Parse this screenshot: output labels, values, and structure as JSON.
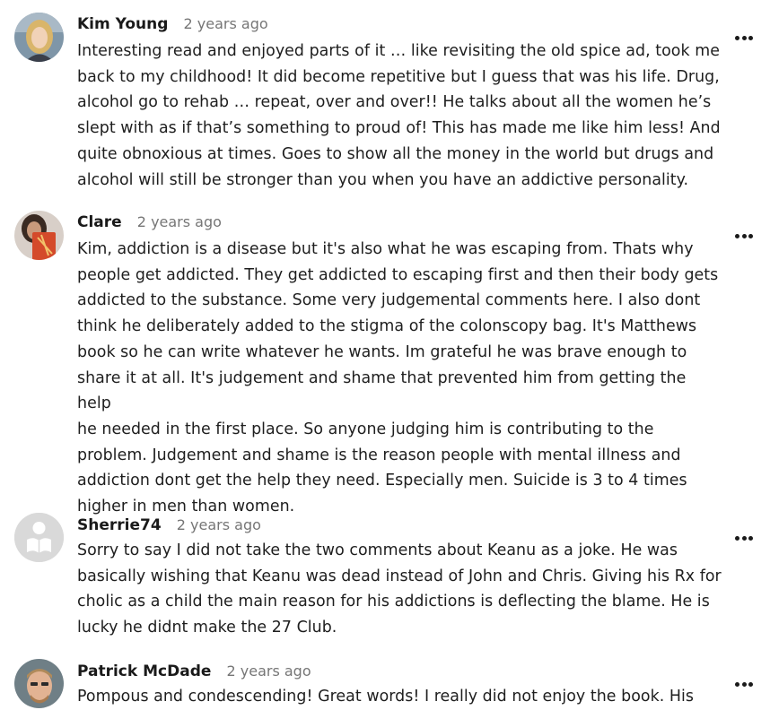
{
  "comments": [
    {
      "author": "Kim Young",
      "time": "2 years ago",
      "text": "Interesting read and enjoyed parts of it … like revisiting the old spice ad, took me\nback to my childhood! It did become repetitive but I guess that was his life. Drug,\nalcohol go to rehab … repeat, over and over!! He talks about all the women he’s\nslept with as if that’s something to proud of! This has made me like him less! And\nquite obnoxious at times. Goes to show all the money in the world but drugs and\nalcohol will still be stronger than you when you have an addictive personality."
    },
    {
      "author": "Clare",
      "time": "2 years ago",
      "text": "Kim, addiction is a disease but it's also what he was escaping from. Thats why\npeople get addicted. They get addicted to escaping first and then their body gets\naddicted to the substance. Some very judgemental comments here. I also dont\nthink he deliberately added to the stigma of the colonscopy bag. It's Matthews\nbook so he can write whatever he wants. Im grateful he was brave enough to\nshare it at all. It's judgement and shame that prevented him from getting the help\nhe needed in the first place. So anyone judging him is contributing to the\nproblem. Judgement and shame is the reason people with mental illness and\naddiction dont get the help they need. Especially men. Suicide is 3 to 4 times\nhigher in men than women."
    },
    {
      "author": "Sherrie74",
      "time": "2 years ago",
      "text": "Sorry to say I did not take the two comments about Keanu as a joke. He was\nbasically wishing that Keanu was dead instead of John and Chris. Giving his Rx for\ncholic as a child the main reason for his addictions is deflecting the blame. He is\nlucky he didnt make the 27 Club."
    },
    {
      "author": "Patrick McDade",
      "time": "2 years ago",
      "text": "Pompous and condescending! Great words! I really did not enjoy the book. His"
    }
  ],
  "icons": {
    "more": "more-options-icon",
    "default_avatar": "book-reader-avatar-icon"
  },
  "colors": {
    "text": "#1e1e1e",
    "muted": "#767676",
    "avatar_placeholder": "#d9d9d9"
  }
}
